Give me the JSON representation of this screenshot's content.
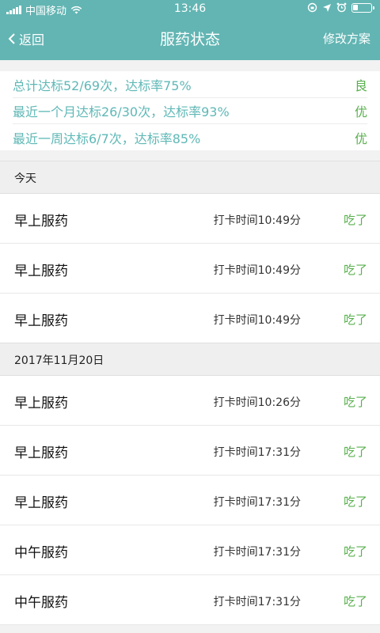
{
  "status_bar": {
    "carrier": "中国移动",
    "time": "13:46"
  },
  "nav": {
    "back_label": "返回",
    "title": "服药状态",
    "right_action": "修改方案"
  },
  "summary": [
    {
      "text": "总计达标52/69次，达标率75%",
      "grade": "良"
    },
    {
      "text": "最近一个月达标26/30次，达标率93%",
      "grade": "优"
    },
    {
      "text": "最近一周达标6/7次，达标率85%",
      "grade": "优"
    }
  ],
  "sections": [
    {
      "title": "今天",
      "rows": [
        {
          "label": "早上服药",
          "time": "打卡时间10:49分",
          "status": "吃了"
        },
        {
          "label": "早上服药",
          "time": "打卡时间10:49分",
          "status": "吃了"
        },
        {
          "label": "早上服药",
          "time": "打卡时间10:49分",
          "status": "吃了"
        }
      ]
    },
    {
      "title": "2017年11月20日",
      "rows": [
        {
          "label": "早上服药",
          "time": "打卡时间10:26分",
          "status": "吃了"
        },
        {
          "label": "早上服药",
          "time": "打卡时间17:31分",
          "status": "吃了"
        },
        {
          "label": "早上服药",
          "time": "打卡时间17:31分",
          "status": "吃了"
        },
        {
          "label": "中午服药",
          "time": "打卡时间17:31分",
          "status": "吃了"
        },
        {
          "label": "中午服药",
          "time": "打卡时间17:31分",
          "status": "吃了"
        }
      ]
    }
  ],
  "colors": {
    "header": "#62b5b3",
    "summary_text": "#5fb8b6",
    "ok_green": "#5ab04f"
  }
}
